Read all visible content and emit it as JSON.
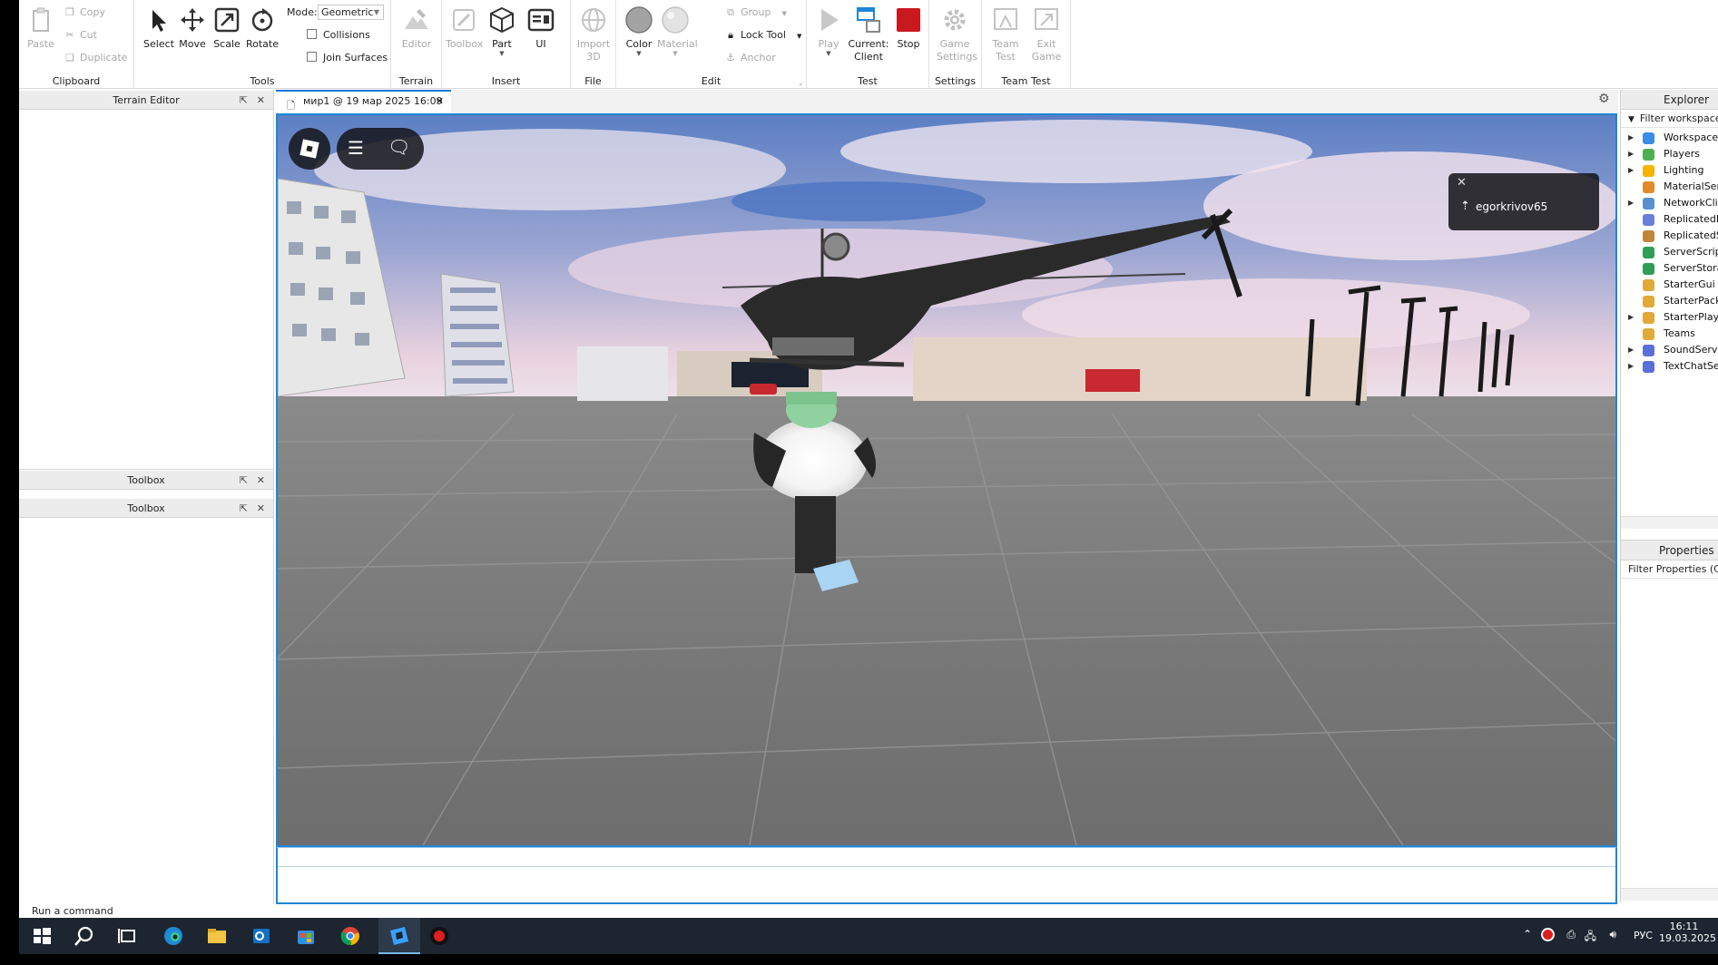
{
  "ribbon": {
    "clipboard": {
      "paste": "Paste",
      "copy": "Copy",
      "cut": "Cut",
      "duplicate": "Duplicate",
      "group_label": "Clipboard"
    },
    "tools": {
      "select": "Select",
      "move": "Move",
      "scale": "Scale",
      "rotate": "Rotate",
      "mode_label": "Mode:",
      "mode_value": "Geometric",
      "collisions": "Collisions",
      "join_surfaces": "Join Surfaces",
      "group_label": "Tools"
    },
    "terrain": {
      "editor": "Editor",
      "group_label": "Terrain"
    },
    "insert": {
      "toolbox": "Toolbox",
      "part": "Part",
      "ui": "UI",
      "group_label": "Insert"
    },
    "file": {
      "import_line1": "Import",
      "import_line2": "3D",
      "group_label": "File"
    },
    "edit": {
      "color": "Color",
      "material": "Material",
      "group": "Group",
      "lock_tool": "Lock Tool",
      "anchor": "Anchor",
      "group_label": "Edit"
    },
    "test": {
      "play": "Play",
      "current_line1": "Current:",
      "current_line2": "Client",
      "stop": "Stop",
      "group_label": "Test"
    },
    "settings": {
      "game_line1": "Game",
      "game_line2": "Settings",
      "group_label": "Settings"
    },
    "team_test": {
      "team_line1": "Team",
      "team_line2": "Test",
      "exit_line1": "Exit",
      "exit_line2": "Game",
      "group_label": "Team Test"
    }
  },
  "panels": {
    "terrain_editor": "Terrain Editor",
    "toolbox_1": "Toolbox",
    "toolbox_2": "Toolbox"
  },
  "document_tab": {
    "title": "мир1 @ 19 мар 2025 16:09"
  },
  "viewport": {
    "notification_user": "egorkrivov65"
  },
  "command_bar": {
    "placeholder": "Run a command"
  },
  "explorer": {
    "title": "Explorer",
    "filter": "Filter workspace (C",
    "items": [
      {
        "label": "Workspace",
        "expandable": true,
        "color": "#3a8ee6"
      },
      {
        "label": "Players",
        "expandable": true,
        "color": "#4caf50"
      },
      {
        "label": "Lighting",
        "expandable": true,
        "color": "#f5b400"
      },
      {
        "label": "MaterialService",
        "expandable": false,
        "color": "#e08a2b"
      },
      {
        "label": "NetworkClient",
        "expandable": true,
        "color": "#5a8fd0"
      },
      {
        "label": "ReplicatedFirst",
        "expandable": false,
        "color": "#6b7fd8"
      },
      {
        "label": "ReplicatedStora",
        "expandable": false,
        "color": "#c0863a"
      },
      {
        "label": "ServerScriptServ",
        "expandable": false,
        "color": "#2f9e57"
      },
      {
        "label": "ServerStorage",
        "expandable": false,
        "color": "#2f9e57"
      },
      {
        "label": "StarterGui",
        "expandable": false,
        "color": "#e0a93a"
      },
      {
        "label": "StarterPack",
        "expandable": false,
        "color": "#e0a93a"
      },
      {
        "label": "StarterPlayer",
        "expandable": true,
        "color": "#e0a93a"
      },
      {
        "label": "Teams",
        "expandable": false,
        "color": "#e0a93a"
      },
      {
        "label": "SoundService",
        "expandable": true,
        "color": "#5a6fd8"
      },
      {
        "label": "TextChatService",
        "expandable": true,
        "color": "#5a6fd8"
      }
    ]
  },
  "properties": {
    "title": "Properties",
    "filter": "Filter Properties (Ctrl+Sh"
  },
  "taskbar": {
    "language": "РУС",
    "time": "16:11",
    "date": "19.03.2025"
  },
  "colors": {
    "accent": "#1e86d6",
    "stop_red": "#c8191e",
    "taskbar": "#1c2530"
  }
}
